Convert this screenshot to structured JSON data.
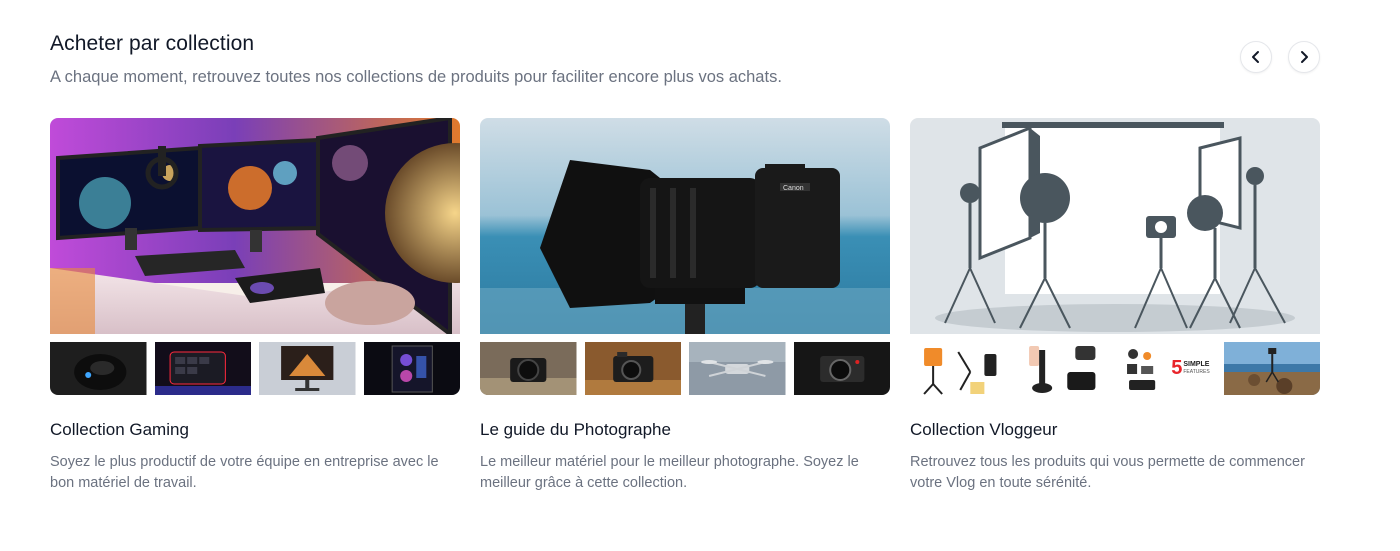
{
  "section": {
    "title": "Acheter par collection",
    "subtitle": "A chaque moment, retrouvez toutes nos collections de produits pour faciliter encore plus vos achats."
  },
  "nav": {
    "prev_icon": "chevron-left-icon",
    "next_icon": "chevron-right-icon"
  },
  "collections": [
    {
      "title": "Collection Gaming",
      "description": "Soyez le plus productif de votre équipe en entreprise avec le bon matériel de travail.",
      "hero_image": "gaming-desk-setup",
      "thumbnails": [
        "gaming-mouse",
        "gaming-keypad",
        "gaming-monitor",
        "gaming-pc-case"
      ]
    },
    {
      "title": "Le guide du Photographe",
      "description": "Le meilleur matériel pour le meilleur photographe. Soyez le meilleur grâce à cette collection.",
      "hero_image": "canon-camera-lens",
      "thumbnails": [
        "camera-on-ground",
        "fujifilm-camera",
        "drone",
        "leica-camera"
      ]
    },
    {
      "title": "Collection Vloggeur",
      "description": "Retrouvez tous les produits qui vous permette de commencer votre Vlog en toute sérénité.",
      "hero_image": "studio-lights-illustration",
      "thumbnails": [
        "vlog-tripod-kit",
        "phone-rig-kit",
        "5-simple-features-kit",
        "tripod-on-beach"
      ],
      "thumbnail_text": {
        "number": "5",
        "line1": "SIMPLE",
        "line2": "FEATURES"
      }
    }
  ]
}
